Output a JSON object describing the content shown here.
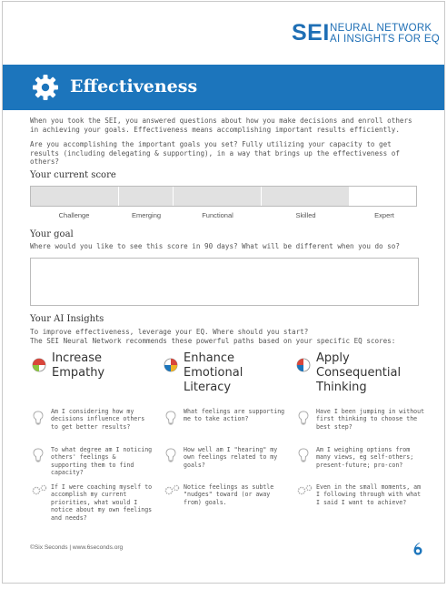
{
  "brand": {
    "sei": "SEI",
    "line1": "NEURAL NETWORK",
    "line2": "AI INSIGHTS FOR EQ",
    "color": "#1f6fb5"
  },
  "banner": {
    "title": "Effectiveness",
    "icon": "gear-icon",
    "color": "#1c75bc"
  },
  "intro": {
    "p1": "When you took the SEI, you answered questions about how you make decisions and enroll others in achieving your goals. Effectiveness means accomplishing important results efficiently.",
    "p2": "Are you accomplishing the important goals you set? Fully utilizing your capacity to get results (including delegating & supporting), in a way that brings up the effectiveness of others?"
  },
  "current_score": {
    "heading": "Your current score",
    "scale": [
      "Challenge",
      "Emerging",
      "Functional",
      "Skilled",
      "Expert"
    ]
  },
  "goal": {
    "heading": "Your goal",
    "prompt": "Where would you like to see this score in 90 days? What will be different when you do so?"
  },
  "insights": {
    "heading": "Your AI Insights",
    "line1": "To improve effectiveness, leverage your EQ. Where should you start?",
    "line2": "The SEI Neural Network recommends these powerful paths based on your specific EQ scores:",
    "columns": [
      {
        "title": [
          "Increase",
          "Empathy"
        ],
        "questions": [
          "Am I considering how my decisions influence others to get better results?",
          "To what degree am I noticing others' feelings & supporting them to find capacity?",
          "If I were coaching myself to accomplish my current priorities, what would I notice about my own feelings and needs?"
        ]
      },
      {
        "title": [
          "Enhance",
          "Emotional",
          "Literacy"
        ],
        "questions": [
          "What feelings are supporting me to take action?",
          "How well am I \"hearing\" my own feelings related to my goals?",
          "Notice feelings as subtle \"nudges\" toward (or away from) goals."
        ]
      },
      {
        "title": [
          "Apply",
          "Consequential",
          "Thinking"
        ],
        "questions": [
          "Have I been jumping in without first thinking to choose the best step?",
          "Am I weighing options from many views, eg self-others; present-future; pro-con?",
          "Even in the small moments, am I following through with what I said I want to achieve?"
        ]
      }
    ]
  },
  "footer": {
    "text": "©Six Seconds | www.6seconds.org",
    "logo_icon": "six-seconds-logo-icon"
  }
}
